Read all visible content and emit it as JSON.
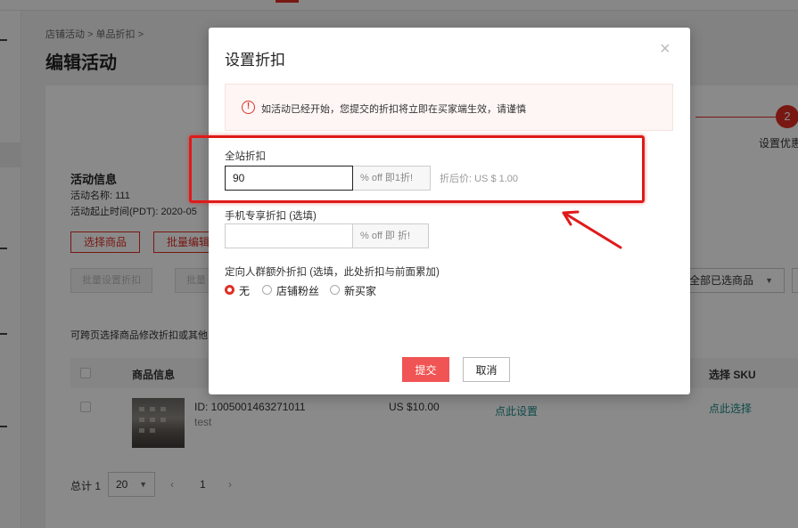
{
  "background": {
    "breadcrumb": "店铺活动  >  单品折扣  >",
    "title": "编辑活动",
    "step_number": "2",
    "step_label": "设置优惠",
    "info_title": "活动信息",
    "info_name": "活动名称:   111",
    "info_period": "活动起止时间(PDT):   2020-05",
    "btn_select_products": "选择商品",
    "btn_batch": "批量编辑",
    "btn_disabled_1": "批量设置折扣",
    "btn_disabled_2": "批量",
    "filter_select": "全部已选商品",
    "hint": "可跨页选择商品修改折扣或其他",
    "table_headers": {
      "product_info": "商品信息",
      "select_sku": "选择 SKU"
    },
    "row": {
      "id": "ID: 1005001463271011",
      "name": "test",
      "price": "US $10.00",
      "set_link": "点此设置",
      "sku_link": "点此选择"
    },
    "footer_total": "总计 1",
    "page_size": "20",
    "page_current": "1",
    "pager_prev": "‹",
    "pager_next": "›"
  },
  "modal": {
    "title": "设置折扣",
    "close_glyph": "×",
    "alert_icon_glyph": "!",
    "alert_text": "如活动已经开始，您提交的折扣将立即在买家端生效，请谨慎",
    "site_discount": {
      "label": "全站折扣",
      "value": "90",
      "suffix": "% off 即1折!",
      "after_price": "折后价: US $ 1.00"
    },
    "mobile_discount": {
      "label": "手机专享折扣 (选填)",
      "value": "",
      "suffix": "% off 即 折!"
    },
    "target_discount": {
      "label": "定向人群额外折扣 (选填，此处折扣与前面累加)",
      "options": [
        "无",
        "店铺粉丝",
        "新买家"
      ],
      "selected": "无"
    },
    "submit_label": "提交",
    "cancel_label": "取消"
  },
  "colors": {
    "accent": "#e02e24",
    "submit": "#f05454",
    "annotation": "#e01a1a",
    "link": "#1a8a86"
  },
  "icons": [
    "close-icon",
    "warning-circle-icon",
    "dropdown-caret-icon",
    "annotation-arrow-icon"
  ]
}
